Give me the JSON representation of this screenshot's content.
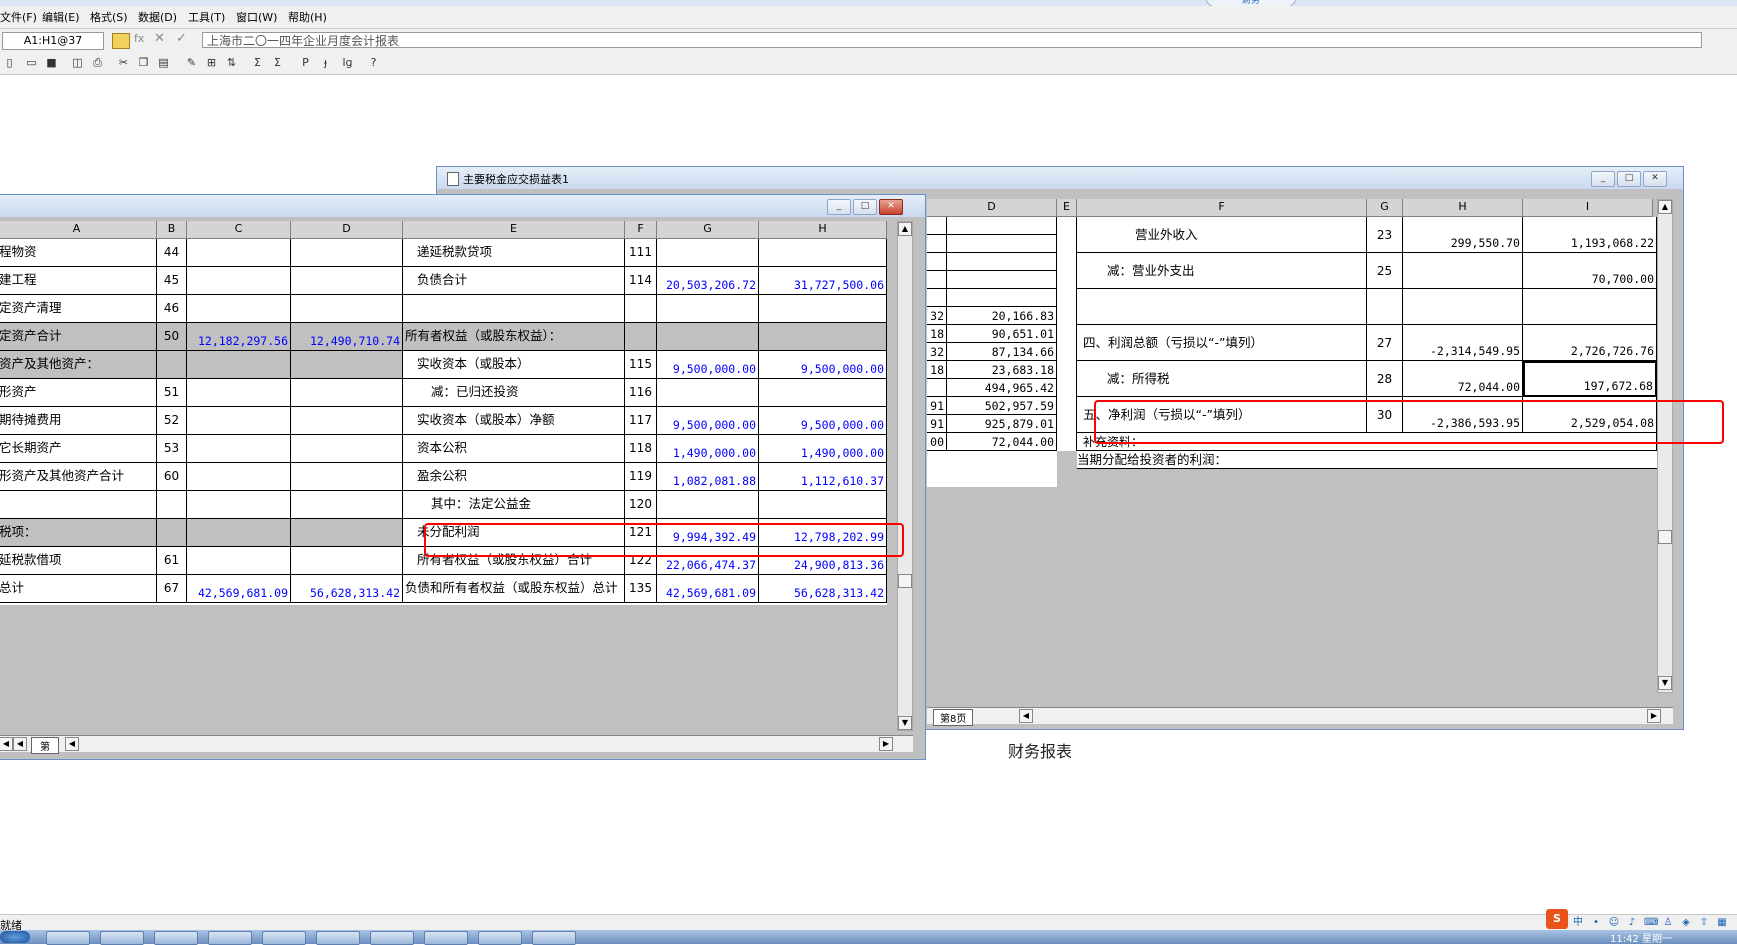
{
  "menu": [
    "文件(F)",
    "编辑(E)",
    "格式(S)",
    "数据(D)",
    "工具(T)",
    "窗口(W)",
    "帮助(H)"
  ],
  "cell_ref": "A1:H1@37",
  "formula": "上海市二〇一四年企业月度会计报表",
  "top_logo": "财务",
  "left_window": {
    "columns": [
      "A",
      "B",
      "C",
      "D",
      "E",
      "F",
      "G",
      "H"
    ],
    "rows": [
      {
        "a": "程物资",
        "b": "44",
        "c": "",
        "d": "",
        "e": "递延税款贷项",
        "f": "111",
        "g": "",
        "h": ""
      },
      {
        "a": "建工程",
        "b": "45",
        "c": "",
        "d": "",
        "e": "负债合计",
        "f": "114",
        "g": "20,503,206.72",
        "h": "31,727,500.06"
      },
      {
        "a": "定资产清理",
        "b": "46",
        "c": "",
        "d": "",
        "e": "",
        "f": "",
        "g": "",
        "h": ""
      },
      {
        "a": "定资产合计",
        "b": "50",
        "c": "12,182,297.56",
        "d": "12,490,710.74",
        "e": "所有者权益（或股东权益）：",
        "f": "",
        "g": "",
        "h": ""
      },
      {
        "a": "资产及其他资产：",
        "b": "",
        "c": "",
        "d": "",
        "e": "实收资本（或股本）",
        "f": "115",
        "g": "9,500,000.00",
        "h": "9,500,000.00"
      },
      {
        "a": "形资产",
        "b": "51",
        "c": "",
        "d": "",
        "e": "减：已归还投资",
        "f": "116",
        "g": "",
        "h": ""
      },
      {
        "a": "期待摊费用",
        "b": "52",
        "c": "",
        "d": "",
        "e": "实收资本（或股本）净额",
        "f": "117",
        "g": "9,500,000.00",
        "h": "9,500,000.00"
      },
      {
        "a": "它长期资产",
        "b": "53",
        "c": "",
        "d": "",
        "e": "资本公积",
        "f": "118",
        "g": "1,490,000.00",
        "h": "1,490,000.00"
      },
      {
        "a": "形资产及其他资产合计",
        "b": "60",
        "c": "",
        "d": "",
        "e": "盈余公积",
        "f": "119",
        "g": "1,082,081.88",
        "h": "1,112,610.37"
      },
      {
        "a": "",
        "b": "",
        "c": "",
        "d": "",
        "e": "其中：法定公益金",
        "f": "120",
        "g": "",
        "h": ""
      },
      {
        "a": "税项：",
        "b": "",
        "c": "",
        "d": "",
        "e": "未分配利润",
        "f": "121",
        "g": "9,994,392.49",
        "h": "12,798,202.99"
      },
      {
        "a": "延税款借项",
        "b": "61",
        "c": "",
        "d": "",
        "e": "所有者权益（或股东权益）合计",
        "f": "122",
        "g": "22,066,474.37",
        "h": "24,900,813.36"
      },
      {
        "a": "总计",
        "b": "67",
        "c": "42,569,681.09",
        "d": "56,628,313.42",
        "e": "负债和所有者权益（或股东权益）总计",
        "f": "135",
        "g": "42,569,681.09",
        "h": "56,628,313.42"
      }
    ],
    "tab_label": "第"
  },
  "right_window": {
    "title": "主要税金应交损益表1",
    "columns": [
      "D",
      "E",
      "F",
      "G",
      "H",
      "I"
    ],
    "c_fragments": [
      "32",
      "18",
      "32",
      "18",
      "",
      "91",
      "91",
      "00"
    ],
    "d_values": [
      "20,166.83",
      "90,651.01",
      "87,134.66",
      "23,683.18",
      "494,965.42",
      "502,957.59",
      "925,879.01",
      "72,044.00"
    ],
    "rows": [
      {
        "f": "营业外收入",
        "g": "23",
        "h": "299,550.70",
        "i": "1,193,068.22"
      },
      {
        "f": "减：营业外支出",
        "g": "25",
        "h": "",
        "i": "70,700.00"
      },
      {
        "f": "",
        "g": "",
        "h": "",
        "i": ""
      },
      {
        "f": "四、利润总额（亏损以“-”填列）",
        "g": "27",
        "h": "-2,314,549.95",
        "i": "2,726,726.76"
      },
      {
        "f": "减：所得税",
        "g": "28",
        "h": "72,044.00",
        "i": "197,672.68"
      },
      {
        "f": "五、净利润（亏损以“-”填列）",
        "g": "30",
        "h": "-2,386,593.95",
        "i": "2,529,054.08"
      }
    ],
    "extra_lines": [
      "补充资料：",
      "当期分配给投资者的利润："
    ],
    "tab_label": "第8页"
  },
  "desktop_caption": "财务报表",
  "status": "就绪",
  "clock": "11:42 星期一"
}
